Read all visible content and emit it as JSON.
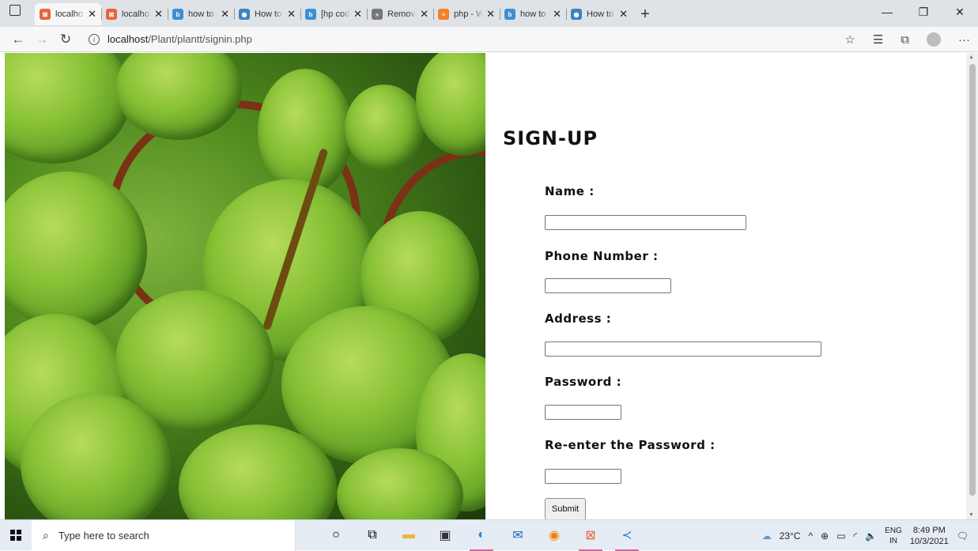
{
  "browser": {
    "tabs": [
      {
        "label": "localhost/Plant",
        "favicon_color": "#e8643c",
        "active": true
      },
      {
        "label": "localhost/Plant",
        "favicon_color": "#e8643c",
        "active": false
      },
      {
        "label": "how to insert",
        "favicon_color": "#3b8fd6",
        "active": false
      },
      {
        "label": "How to insert",
        "favicon_color": "#3b82c4",
        "active": false
      },
      {
        "label": "[hp code b",
        "favicon_color": "#3b8fd6",
        "active": false
      },
      {
        "label": "Removing",
        "favicon_color": "#777777",
        "active": false
      },
      {
        "label": "php - Warn",
        "favicon_color": "#f48024",
        "active": false
      },
      {
        "label": "how to inse",
        "favicon_color": "#3b8fd6",
        "active": false
      },
      {
        "label": "How to ins",
        "favicon_color": "#3b82c4",
        "active": false
      }
    ],
    "url_host": "localhost",
    "url_path": "/Plant/plantt/signin.php"
  },
  "form": {
    "heading": "SIGN-UP",
    "name_label": "Name :",
    "phone_label": "Phone Number :",
    "address_label": "Address :",
    "password_label": "Password :",
    "repassword_label": "Re-enter the Password :",
    "name_value": "",
    "phone_value": "",
    "address_value": "",
    "password_value": "",
    "repassword_value": "",
    "submit_label": "Submit"
  },
  "taskbar": {
    "search_placeholder": "Type here to search",
    "weather": "23°C",
    "lang_top": "ENG",
    "lang_bottom": "IN",
    "time": "8:49 PM",
    "date": "10/3/2021"
  }
}
